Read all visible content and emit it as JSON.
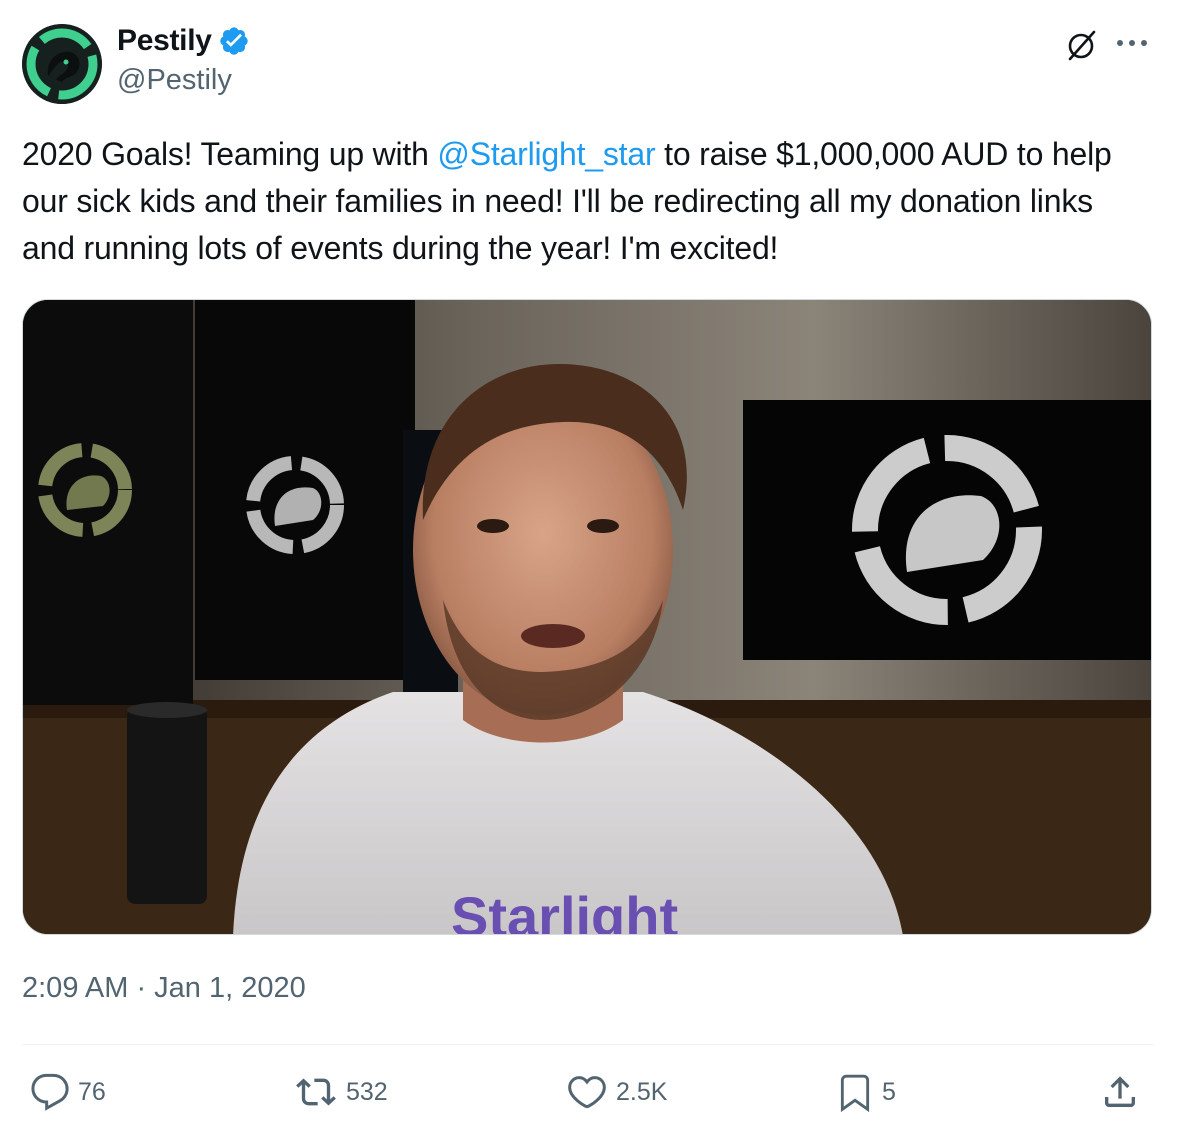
{
  "author": {
    "display_name": "Pestily",
    "handle": "@Pestily",
    "verified": true,
    "verified_color": "#1d9bf0"
  },
  "tweet": {
    "text_before_mention": "2020 Goals! Teaming up with ",
    "mention": "@Starlight_star",
    "text_after_mention": " to raise $1,000,000 AUD to help our sick kids and their families in need! I'll be redirecting all my donation links and running lots of events during the year! I'm excited!",
    "mention_color": "#1d9bf0",
    "timestamp": "2:09 AM · Jan 1, 2020"
  },
  "media": {
    "type": "video-thumbnail",
    "shirt_text": "Starlight"
  },
  "actions": {
    "replies": "76",
    "retweets": "532",
    "likes": "2.5K",
    "bookmarks": "5"
  },
  "icons": {
    "verified": "verified-badge-icon",
    "grok": "grok-icon",
    "more": "more-options-icon",
    "reply": "reply-icon",
    "retweet": "retweet-icon",
    "like": "heart-icon",
    "bookmark": "bookmark-icon",
    "share": "share-icon"
  }
}
